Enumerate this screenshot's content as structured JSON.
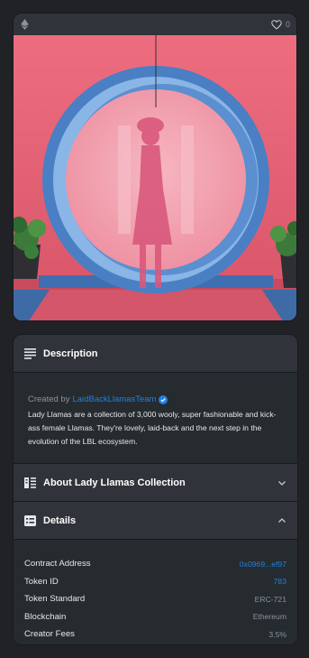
{
  "image_card": {
    "chain_icon": "ethereum-icon",
    "favorite_icon": "heart-icon",
    "favorite_count": "0",
    "artwork_icon": "lady-llama-artwork"
  },
  "description": {
    "heading": "Description",
    "icon": "lines-icon",
    "created_by_prefix": "Created by",
    "creator": "LaidBackLlamasTeam",
    "verified_icon": "verified-badge-icon",
    "text": "Lady Llamas are a collection of 3,000 wooly, super fashionable and kick-ass female Llamas. They're lovely, laid-back and the next step in the evolution of the LBL ecosystem."
  },
  "about": {
    "heading": "About Lady Llamas Collection",
    "icon": "collection-info-icon",
    "chevron": "chevron-down-icon"
  },
  "details": {
    "heading": "Details",
    "icon": "details-card-icon",
    "chevron": "chevron-up-icon",
    "rows": [
      {
        "key": "Contract Address",
        "value": "0x0969...ef97",
        "link": true
      },
      {
        "key": "Token ID",
        "value": "783",
        "link": true
      },
      {
        "key": "Token Standard",
        "value": "ERC-721",
        "link": false
      },
      {
        "key": "Blockchain",
        "value": "Ethereum",
        "link": false
      },
      {
        "key": "Creator Fees",
        "value": "3.5%",
        "link": false
      }
    ]
  },
  "colors": {
    "background": "#202225",
    "panel": "#303339",
    "panel_body": "#262b2f",
    "link": "#2081e2",
    "muted": "#8a939b"
  }
}
